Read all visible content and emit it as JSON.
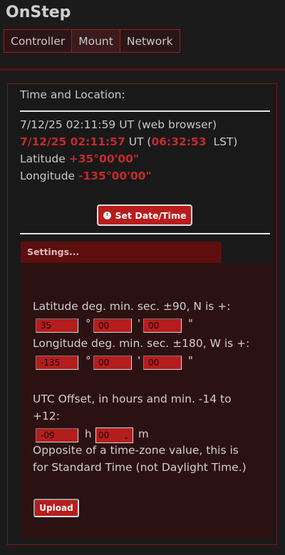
{
  "app": {
    "title": "OnStep"
  },
  "nav": {
    "items": [
      "Controller",
      "Mount",
      "Network"
    ],
    "active": "Mount"
  },
  "time_location": {
    "title": "Time and Location:",
    "browser_time": "7/12/25 02:11:59 UT (web browser)",
    "mount_date_time": "7/12/25 02:11:57",
    "ut_label": "UT (",
    "lst_value": "06:32:53",
    "lst_label": "LST)",
    "latitude_label": "Latitude",
    "latitude_value": "+35°00'00\"",
    "longitude_label": "Longitude",
    "longitude_value": "-135°00'00\"",
    "set_button": "Set Date/Time"
  },
  "settings": {
    "header": "Settings...",
    "latitude_label": "Latitude deg. min. sec. ±90, N is +:",
    "latitude": {
      "deg": "35",
      "min": "00",
      "sec": "00"
    },
    "longitude_label": "Longitude deg. min. sec. ±180, W is +:",
    "longitude": {
      "deg": "-135",
      "min": "00",
      "sec": "00"
    },
    "deg_symbol": "°",
    "min_symbol": "'",
    "sec_symbol": "\"",
    "utc_label_line1": "UTC Offset, in hours and min. -14 to",
    "utc_label_line2": "+12:",
    "utc_hours": "-09",
    "h_unit": "h",
    "utc_minutes": "00",
    "m_unit": "m",
    "note_line1": "Opposite of a time-zone value, this is",
    "note_line2": "for Standard Time (not Daylight Time.)",
    "upload_button": "Upload"
  },
  "colors": {
    "accent": "#b81c1c",
    "highlight_text": "#c62a2a",
    "background": "#1b1b1b"
  },
  "icons": {
    "set_time": "clock-icon",
    "dropdown": "chevron-down-icon"
  }
}
